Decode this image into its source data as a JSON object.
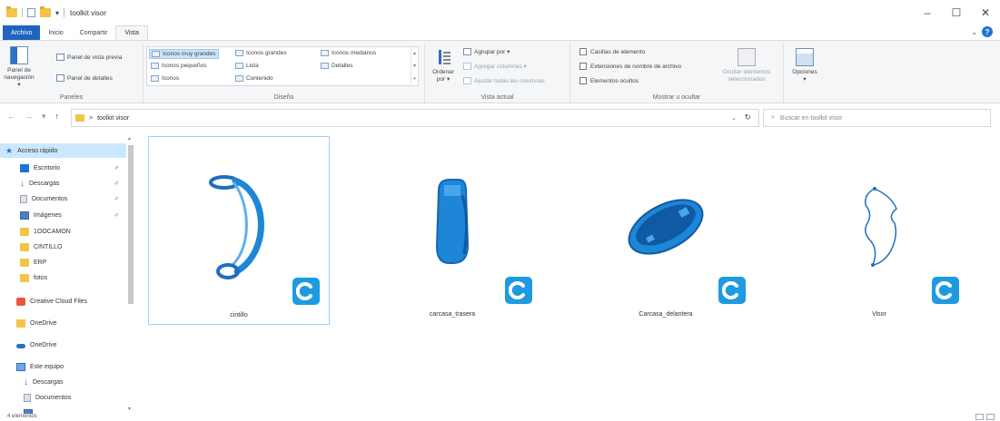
{
  "window": {
    "title": "toolkit visor",
    "minimize": "–",
    "maximize": "☐",
    "close": "✕"
  },
  "tabs": {
    "file": "Archivo",
    "home": "Inicio",
    "share": "Compartir",
    "view": "Vista",
    "collapse": "⌄",
    "help": "?"
  },
  "ribbon": {
    "panes": {
      "nav_pane_label": "Panel de navegación ▾",
      "preview_pane": "Panel de vista previa",
      "details_pane": "Panel de detalles",
      "group": "Paneles"
    },
    "layout": {
      "items": [
        "Iconos muy grandes",
        "Iconos grandes",
        "Iconos medianos",
        "Iconos pequeños",
        "Lista",
        "Detalles",
        "Iconos",
        "Contenido"
      ],
      "group": "Diseño"
    },
    "current_view": {
      "sort_label": "Ordenar por ▾",
      "group_by": "Agrupar por ▾",
      "add_columns": "Agregar columnas ▾",
      "fit_columns": "Ajustar todas las columnas",
      "group": "Vista actual"
    },
    "show_hide": {
      "item_checkboxes": "Casillas de elemento",
      "file_extensions": "Extensiones de nombre de archivo",
      "hidden_items": "Elementos ocultos",
      "hide_selected": "Ocultar elementos seleccionados",
      "group": "Mostrar u ocultar"
    },
    "options": {
      "label": "Opciones",
      "arrow": "▾"
    }
  },
  "address": {
    "path": "toolkit visor",
    "separator": ">",
    "search_placeholder": "Buscar en toolkit visor"
  },
  "sidebar": {
    "quick_access": "Acceso rápido",
    "items": [
      {
        "label": "Escritorio",
        "pinned": true
      },
      {
        "label": "Descargas",
        "pinned": true
      },
      {
        "label": "Documentos",
        "pinned": true
      },
      {
        "label": "Imágenes",
        "pinned": true
      },
      {
        "label": "1OOCAMON",
        "pinned": false
      },
      {
        "label": "CINTILLO",
        "pinned": false
      },
      {
        "label": "ERP",
        "pinned": false
      },
      {
        "label": "fotos",
        "pinned": false
      }
    ],
    "creative_cloud": "Creative Cloud Files",
    "onedrive_folder": "OneDrive",
    "onedrive": "OneDrive",
    "this_pc": "Este equipo",
    "pc_items": [
      "Descargas",
      "Documentos"
    ]
  },
  "files": [
    {
      "name": "cintillo",
      "icon": "cintillo-model-icon"
    },
    {
      "name": "carcasa_trasera",
      "icon": "carcasa-trasera-model-icon"
    },
    {
      "name": "Carcasa_delantera",
      "icon": "carcasa-delantera-model-icon"
    },
    {
      "name": "Visor",
      "icon": "visor-model-icon"
    }
  ],
  "status": {
    "count": "4 elementos"
  },
  "colors": {
    "accent": "#1e74d2",
    "model_blue": "#1e86d6",
    "badge_blue": "#1e9be0",
    "selection": "#cce8ff"
  }
}
